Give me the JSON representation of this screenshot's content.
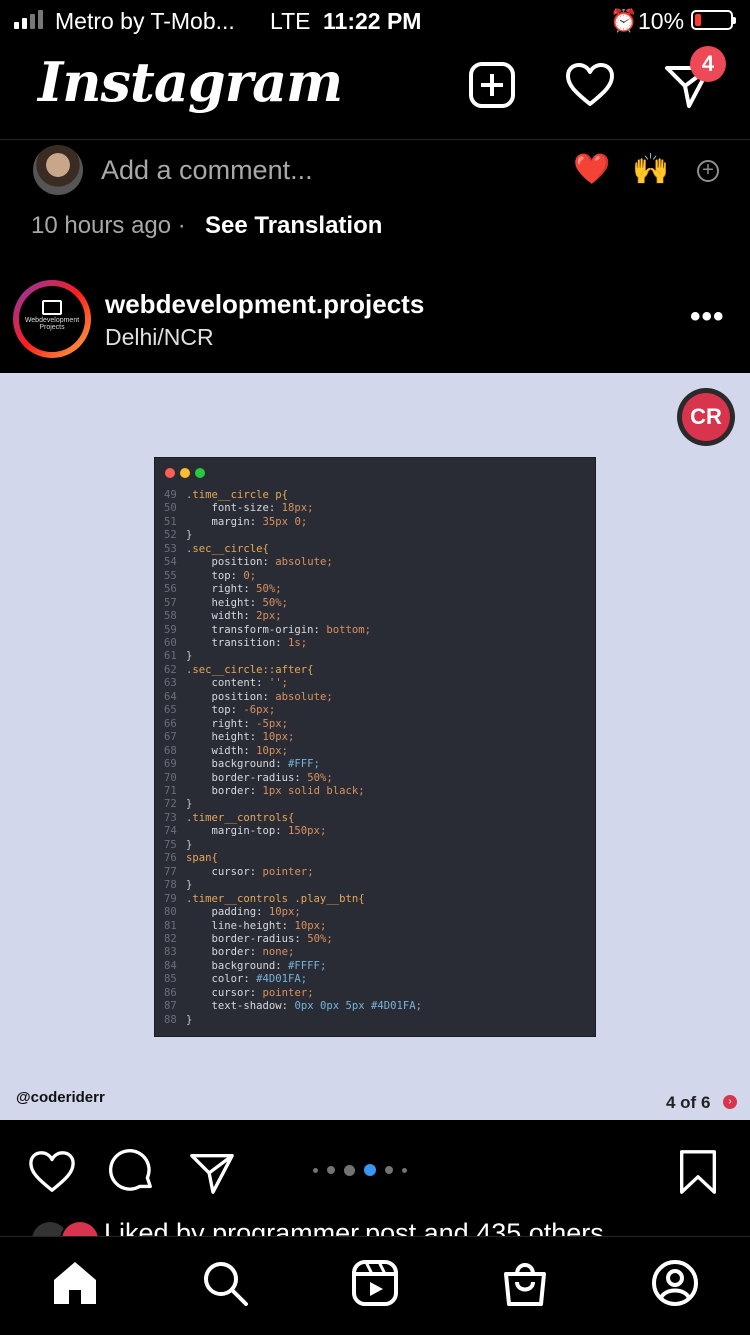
{
  "status_bar": {
    "carrier": "Metro by T-Mob...",
    "network": "LTE",
    "time": "11:22 PM",
    "battery": "10%",
    "battery_level": 0.1
  },
  "header": {
    "app_name": "Instagram",
    "dm_badge": "4"
  },
  "comment_row": {
    "placeholder": "Add a comment...",
    "emoji_1": "❤️",
    "emoji_2": "🙌"
  },
  "meta": {
    "timestamp": "10 hours ago",
    "separator": "·",
    "translation_link": "See Translation"
  },
  "post": {
    "username": "webdevelopment.projects",
    "location": "Delhi/NCR",
    "avatar_text": "Webdevelopment Projects",
    "watermark_logo": "CR",
    "handle": "@coderiderr",
    "page_indicator": "4 of 6",
    "carousel_total": 6,
    "carousel_current": 4,
    "liked_by": "Liked by programmer.post and 435 others"
  },
  "code_window": {
    "lines": [
      {
        "n": "49",
        "t": ".time__circle p{"
      },
      {
        "n": "50",
        "t": "    font-size: 18px;"
      },
      {
        "n": "51",
        "t": "    margin: 35px 0;"
      },
      {
        "n": "52",
        "t": "}"
      },
      {
        "n": "53",
        "t": ".sec__circle{"
      },
      {
        "n": "54",
        "t": "    position: absolute;"
      },
      {
        "n": "55",
        "t": "    top: 0;"
      },
      {
        "n": "56",
        "t": "    right: 50%;"
      },
      {
        "n": "57",
        "t": "    height: 50%;"
      },
      {
        "n": "58",
        "t": "    width: 2px;"
      },
      {
        "n": "59",
        "t": "    transform-origin: bottom;"
      },
      {
        "n": "60",
        "t": "    transition: 1s;"
      },
      {
        "n": "61",
        "t": "}"
      },
      {
        "n": "62",
        "t": ".sec__circle::after{"
      },
      {
        "n": "63",
        "t": "    content: '';"
      },
      {
        "n": "64",
        "t": "    position: absolute;"
      },
      {
        "n": "65",
        "t": "    top: -6px;"
      },
      {
        "n": "66",
        "t": "    right: -5px;"
      },
      {
        "n": "67",
        "t": "    height: 10px;"
      },
      {
        "n": "68",
        "t": "    width: 10px;"
      },
      {
        "n": "69",
        "t": "    background: #FFF;"
      },
      {
        "n": "70",
        "t": "    border-radius: 50%;"
      },
      {
        "n": "71",
        "t": "    border: 1px solid black;"
      },
      {
        "n": "72",
        "t": "}"
      },
      {
        "n": "73",
        "t": ".timer__controls{"
      },
      {
        "n": "74",
        "t": "    margin-top: 150px;"
      },
      {
        "n": "75",
        "t": "}"
      },
      {
        "n": "76",
        "t": "span{"
      },
      {
        "n": "77",
        "t": "    cursor: pointer;"
      },
      {
        "n": "78",
        "t": "}"
      },
      {
        "n": "79",
        "t": ".timer__controls .play__btn{"
      },
      {
        "n": "80",
        "t": "    padding: 10px;"
      },
      {
        "n": "81",
        "t": "    line-height: 10px;"
      },
      {
        "n": "82",
        "t": "    border-radius: 50%;"
      },
      {
        "n": "83",
        "t": "    border: none;"
      },
      {
        "n": "84",
        "t": "    background: #FFFF;"
      },
      {
        "n": "85",
        "t": "    color: #4D01FA;"
      },
      {
        "n": "86",
        "t": "    cursor: pointer;"
      },
      {
        "n": "87",
        "t": "    text-shadow: 0px 0px 5px #4D01FA;"
      },
      {
        "n": "88",
        "t": "}"
      }
    ]
  },
  "colors": {
    "background": "#000000",
    "post_bg": "#d3d7ec",
    "code_bg": "#292c35",
    "badge": "#ed4956",
    "carousel_active": "#3897f0",
    "selector": "#e5a85a",
    "value": "#d9925f"
  },
  "icons": {
    "header": [
      "new-post-icon",
      "heart-icon",
      "direct-message-icon"
    ],
    "actions": [
      "like-icon",
      "comment-icon",
      "share-icon",
      "save-icon"
    ],
    "nav": [
      "home-icon",
      "search-icon",
      "reels-icon",
      "shop-icon",
      "profile-icon"
    ]
  }
}
